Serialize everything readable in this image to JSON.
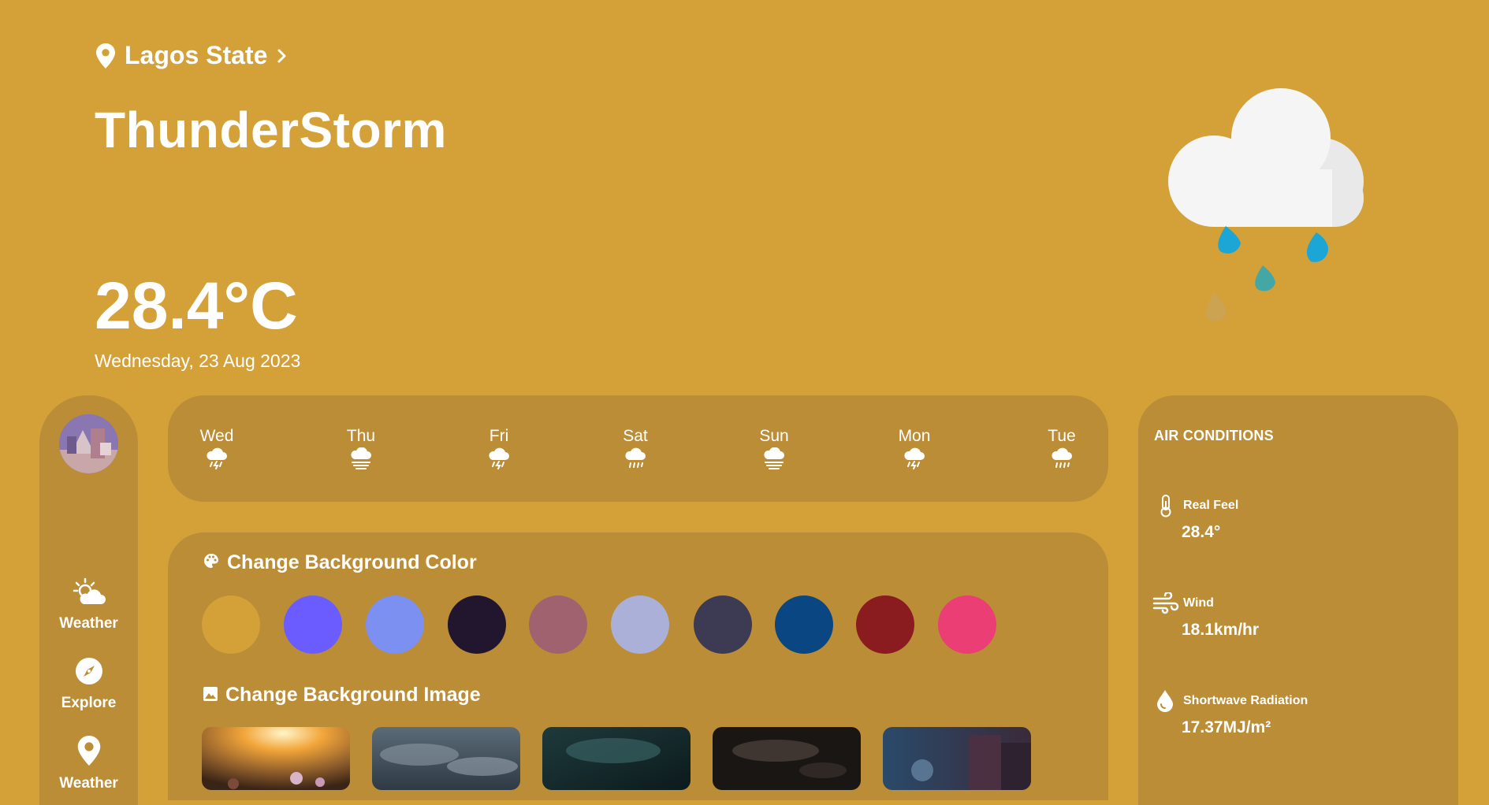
{
  "location": {
    "name": "Lagos State",
    "icon": "map-pin-icon",
    "chevron": "chevron-right-icon"
  },
  "condition": "ThunderStorm",
  "temperature": "28.4°C",
  "date": "Wednesday, 23 Aug 2023",
  "current_icon": "rain-cloud-icon",
  "sidebar": {
    "items": [
      {
        "label": "Weather",
        "icon": "sun-cloud-icon"
      },
      {
        "label": "Explore",
        "icon": "compass-icon"
      },
      {
        "label": "Weather",
        "icon": "map-pin-icon"
      }
    ]
  },
  "forecast": {
    "days": [
      {
        "label": "Wed",
        "icon": "thunderstorm-icon"
      },
      {
        "label": "Thu",
        "icon": "fog-icon"
      },
      {
        "label": "Fri",
        "icon": "thunderstorm-icon"
      },
      {
        "label": "Sat",
        "icon": "rain-icon"
      },
      {
        "label": "Sun",
        "icon": "fog-icon"
      },
      {
        "label": "Mon",
        "icon": "thunderstorm-icon"
      },
      {
        "label": "Tue",
        "icon": "rain-icon"
      }
    ]
  },
  "settings": {
    "color_title": "Change Background Color",
    "image_title": "Change Background Image",
    "colors": [
      "#d4a038",
      "#6b5cff",
      "#7b90f0",
      "#22152e",
      "#a0626e",
      "#aab0d8",
      "#3d3a54",
      "#0a4682",
      "#8a1c20",
      "#ea3e74"
    ]
  },
  "air": {
    "title": "AIR CONDITIONS",
    "items": [
      {
        "label": "Real Feel",
        "value": "28.4°",
        "icon": "thermometer-icon"
      },
      {
        "label": "Wind",
        "value": "18.1km/hr",
        "icon": "wind-icon"
      },
      {
        "label": "Shortwave Radiation",
        "value": "17.37MJ/m²",
        "icon": "droplet-icon"
      }
    ]
  }
}
